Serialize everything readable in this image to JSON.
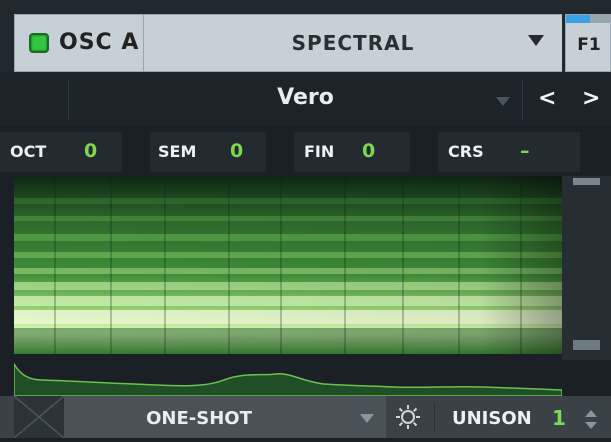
{
  "oscillator": {
    "name": "OSC A",
    "enabled": true,
    "led_color": "#33c640",
    "type": "SPECTRAL",
    "filter_tab": "F1",
    "filter_tab_accent": "#3aa0e8"
  },
  "wavetable": {
    "name": "Vero",
    "prev_icon": "chevron-left-icon",
    "next_icon": "chevron-right-icon",
    "prev_glyph": "<",
    "next_glyph": ">"
  },
  "params": [
    {
      "label": "OCT",
      "value": "0"
    },
    {
      "label": "SEM",
      "value": "0"
    },
    {
      "label": "FIN",
      "value": "0"
    },
    {
      "label": "CRS",
      "value": "–"
    }
  ],
  "bottom": {
    "mode": "ONE-SHOT",
    "settings_icon": "gear-icon",
    "unison_label": "UNISON",
    "unison_value": "1"
  },
  "colors": {
    "accent_green": "#7dd84e",
    "spectrum_bright": "#dcf7b8",
    "spectrum_mid": "#5fb53e",
    "spectrum_dark": "#0e2a14"
  }
}
